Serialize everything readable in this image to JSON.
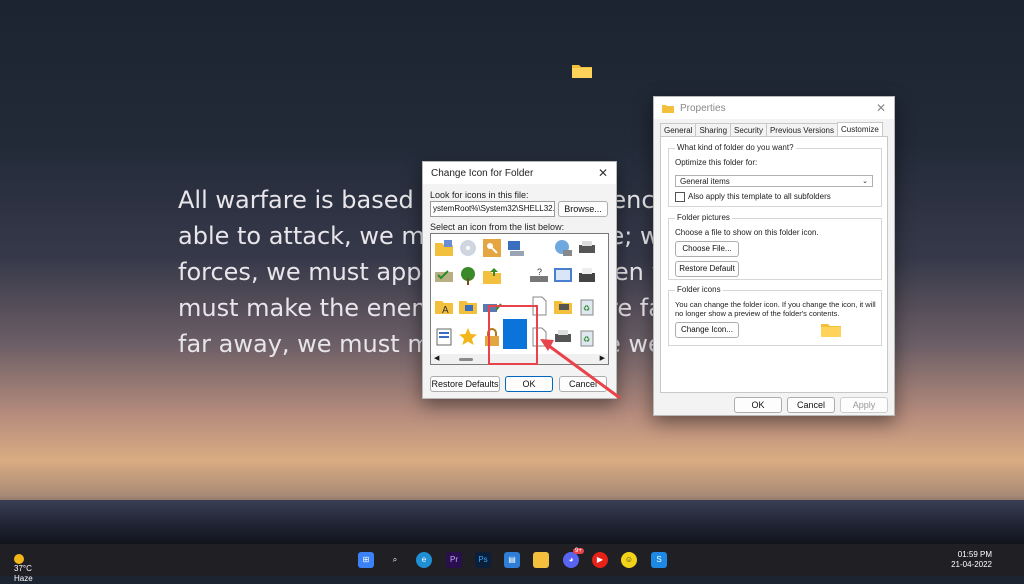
{
  "desktop": {
    "quote_lines": [
      "All warfare is based on deception. Hence, when",
      "able to attack, we must seem unable; when using our",
      "forces, we must appear inactive; when we are near, we",
      "must make the enemy believe we are far away; when",
      "far away, we must make him believe we are near."
    ]
  },
  "change_icon": {
    "title": "Change Icon for  Folder",
    "look_label": "Look for icons in this file:",
    "path_value": "ystemRoot%\\System32\\SHELL32.dll",
    "browse": "Browse...",
    "select_label": "Select an icon from the list below:",
    "restore": "Restore Defaults",
    "ok": "OK",
    "cancel": "Cancel",
    "highlight_color": "#e8434a",
    "selected_color": "#0a74da"
  },
  "properties": {
    "title": "Properties",
    "tabs": [
      "General",
      "Sharing",
      "Security",
      "Previous Versions",
      "Customize"
    ],
    "kind_title": "What kind of folder do you want?",
    "optimize_label": "Optimize this folder for:",
    "optimize_value": "General items",
    "apply_sub": "Also apply this template to all subfolders",
    "pictures_title": "Folder pictures",
    "pictures_desc": "Choose a file to show on this folder icon.",
    "choose_file": "Choose File...",
    "restore_default": "Restore Default",
    "icons_title": "Folder icons",
    "icons_desc_1": "You can change the folder icon. If you change the icon, it will",
    "icons_desc_2": "no longer show a preview of the folder's contents.",
    "change_icon": "Change Icon...",
    "ok": "OK",
    "cancel": "Cancel",
    "apply": "Apply"
  },
  "taskbar": {
    "temp": "37°C",
    "weather": "Haze",
    "time": "01:59 PM",
    "date": "21-04-2022",
    "badge": "9+",
    "apps": [
      "start",
      "search",
      "edge",
      "premiere",
      "photoshop",
      "store",
      "file-explorer",
      "discord",
      "youtube-music",
      "emoji-app",
      "snagit"
    ]
  }
}
